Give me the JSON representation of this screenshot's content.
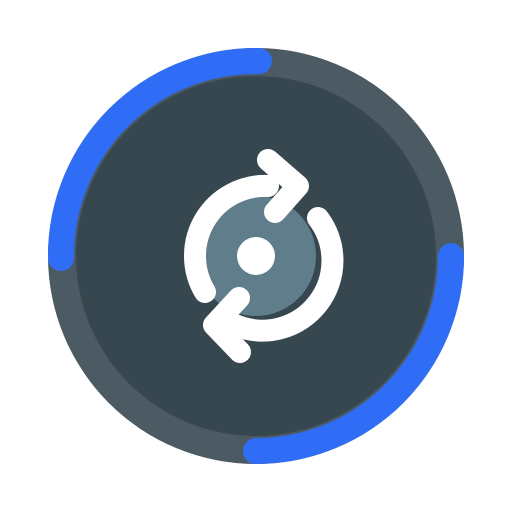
{
  "icon": {
    "name": "sync-disc-icon",
    "colors": {
      "background": "#ffffff",
      "outer_ring": "#4b5a63",
      "inner_disc": "#37474f",
      "center_disc": "#607d8b",
      "progress_arc": "#2f6df6",
      "arrows": "#ffffff",
      "center_hole": "#ffffff"
    }
  }
}
